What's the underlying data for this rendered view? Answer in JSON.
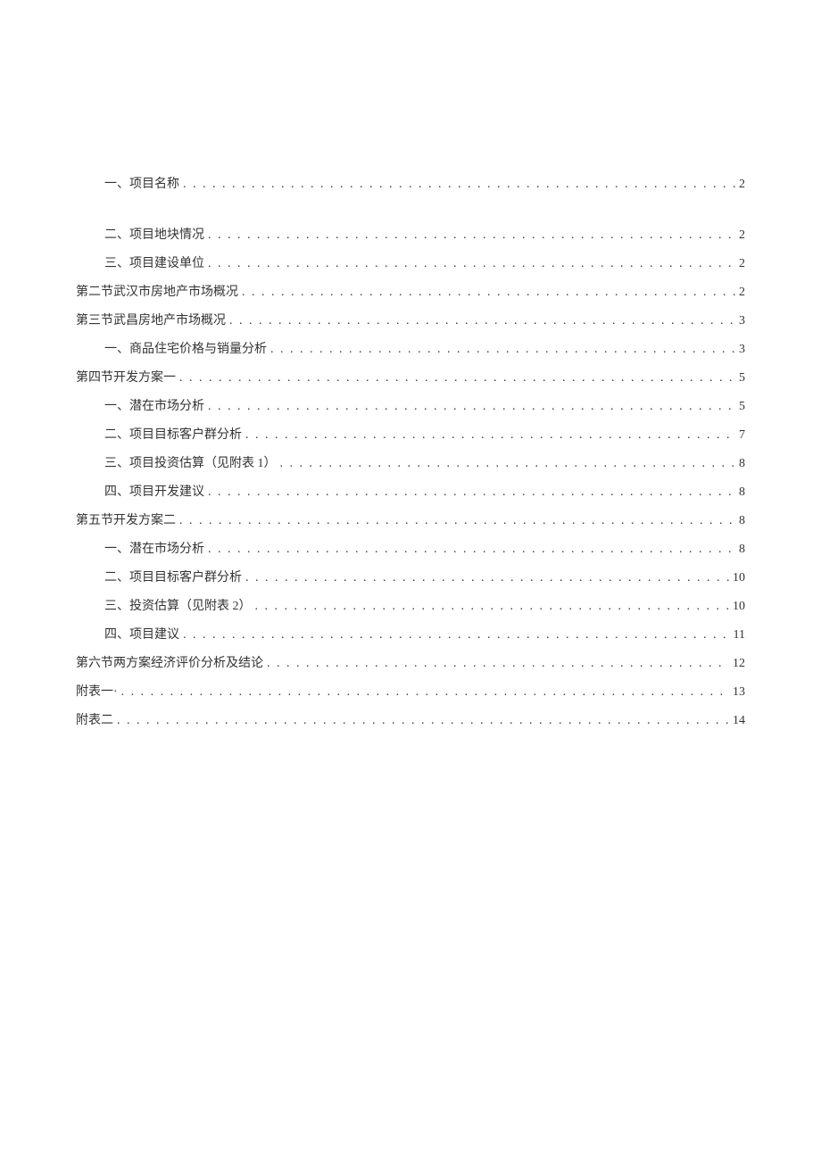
{
  "toc": [
    {
      "level": 1,
      "title": "一、项目名称",
      "page": "2",
      "gap_after": true
    },
    {
      "level": 1,
      "title": "二、项目地块情况",
      "page": "2"
    },
    {
      "level": 1,
      "title": "三、项目建设单位",
      "page": "2"
    },
    {
      "level": 0,
      "title": "第二节武汉市房地产市场概况",
      "page": "2"
    },
    {
      "level": 0,
      "title": "第三节武昌房地产市场概况",
      "page": "3"
    },
    {
      "level": 1,
      "title": "一、商品住宅价格与销量分析",
      "page": "3"
    },
    {
      "level": 0,
      "title": "第四节开发方案一",
      "page": "5"
    },
    {
      "level": 1,
      "title": "一、潜在市场分析",
      "page": "5"
    },
    {
      "level": 1,
      "title": "二、项目目标客户群分析",
      "page": "7"
    },
    {
      "level": 1,
      "title": "三、项目投资估算（见附表 1）",
      "page": "8"
    },
    {
      "level": 1,
      "title": "四、项目开发建议",
      "page": "8"
    },
    {
      "level": 0,
      "title": "第五节开发方案二",
      "page": "8"
    },
    {
      "level": 1,
      "title": "一、潜在市场分析",
      "page": "8"
    },
    {
      "level": 1,
      "title": "二、项目目标客户群分析",
      "page": "10"
    },
    {
      "level": 1,
      "title": "三、投资估算（见附表 2）",
      "page": "10"
    },
    {
      "level": 1,
      "title": "四、项目建议",
      "page": "11"
    },
    {
      "level": 0,
      "title": "第六节两方案经济评价分析及结论",
      "page": "12"
    },
    {
      "level": 0,
      "title": "附表一·",
      "page": "13"
    },
    {
      "level": 0,
      "title": "附表二",
      "page": "14"
    }
  ]
}
